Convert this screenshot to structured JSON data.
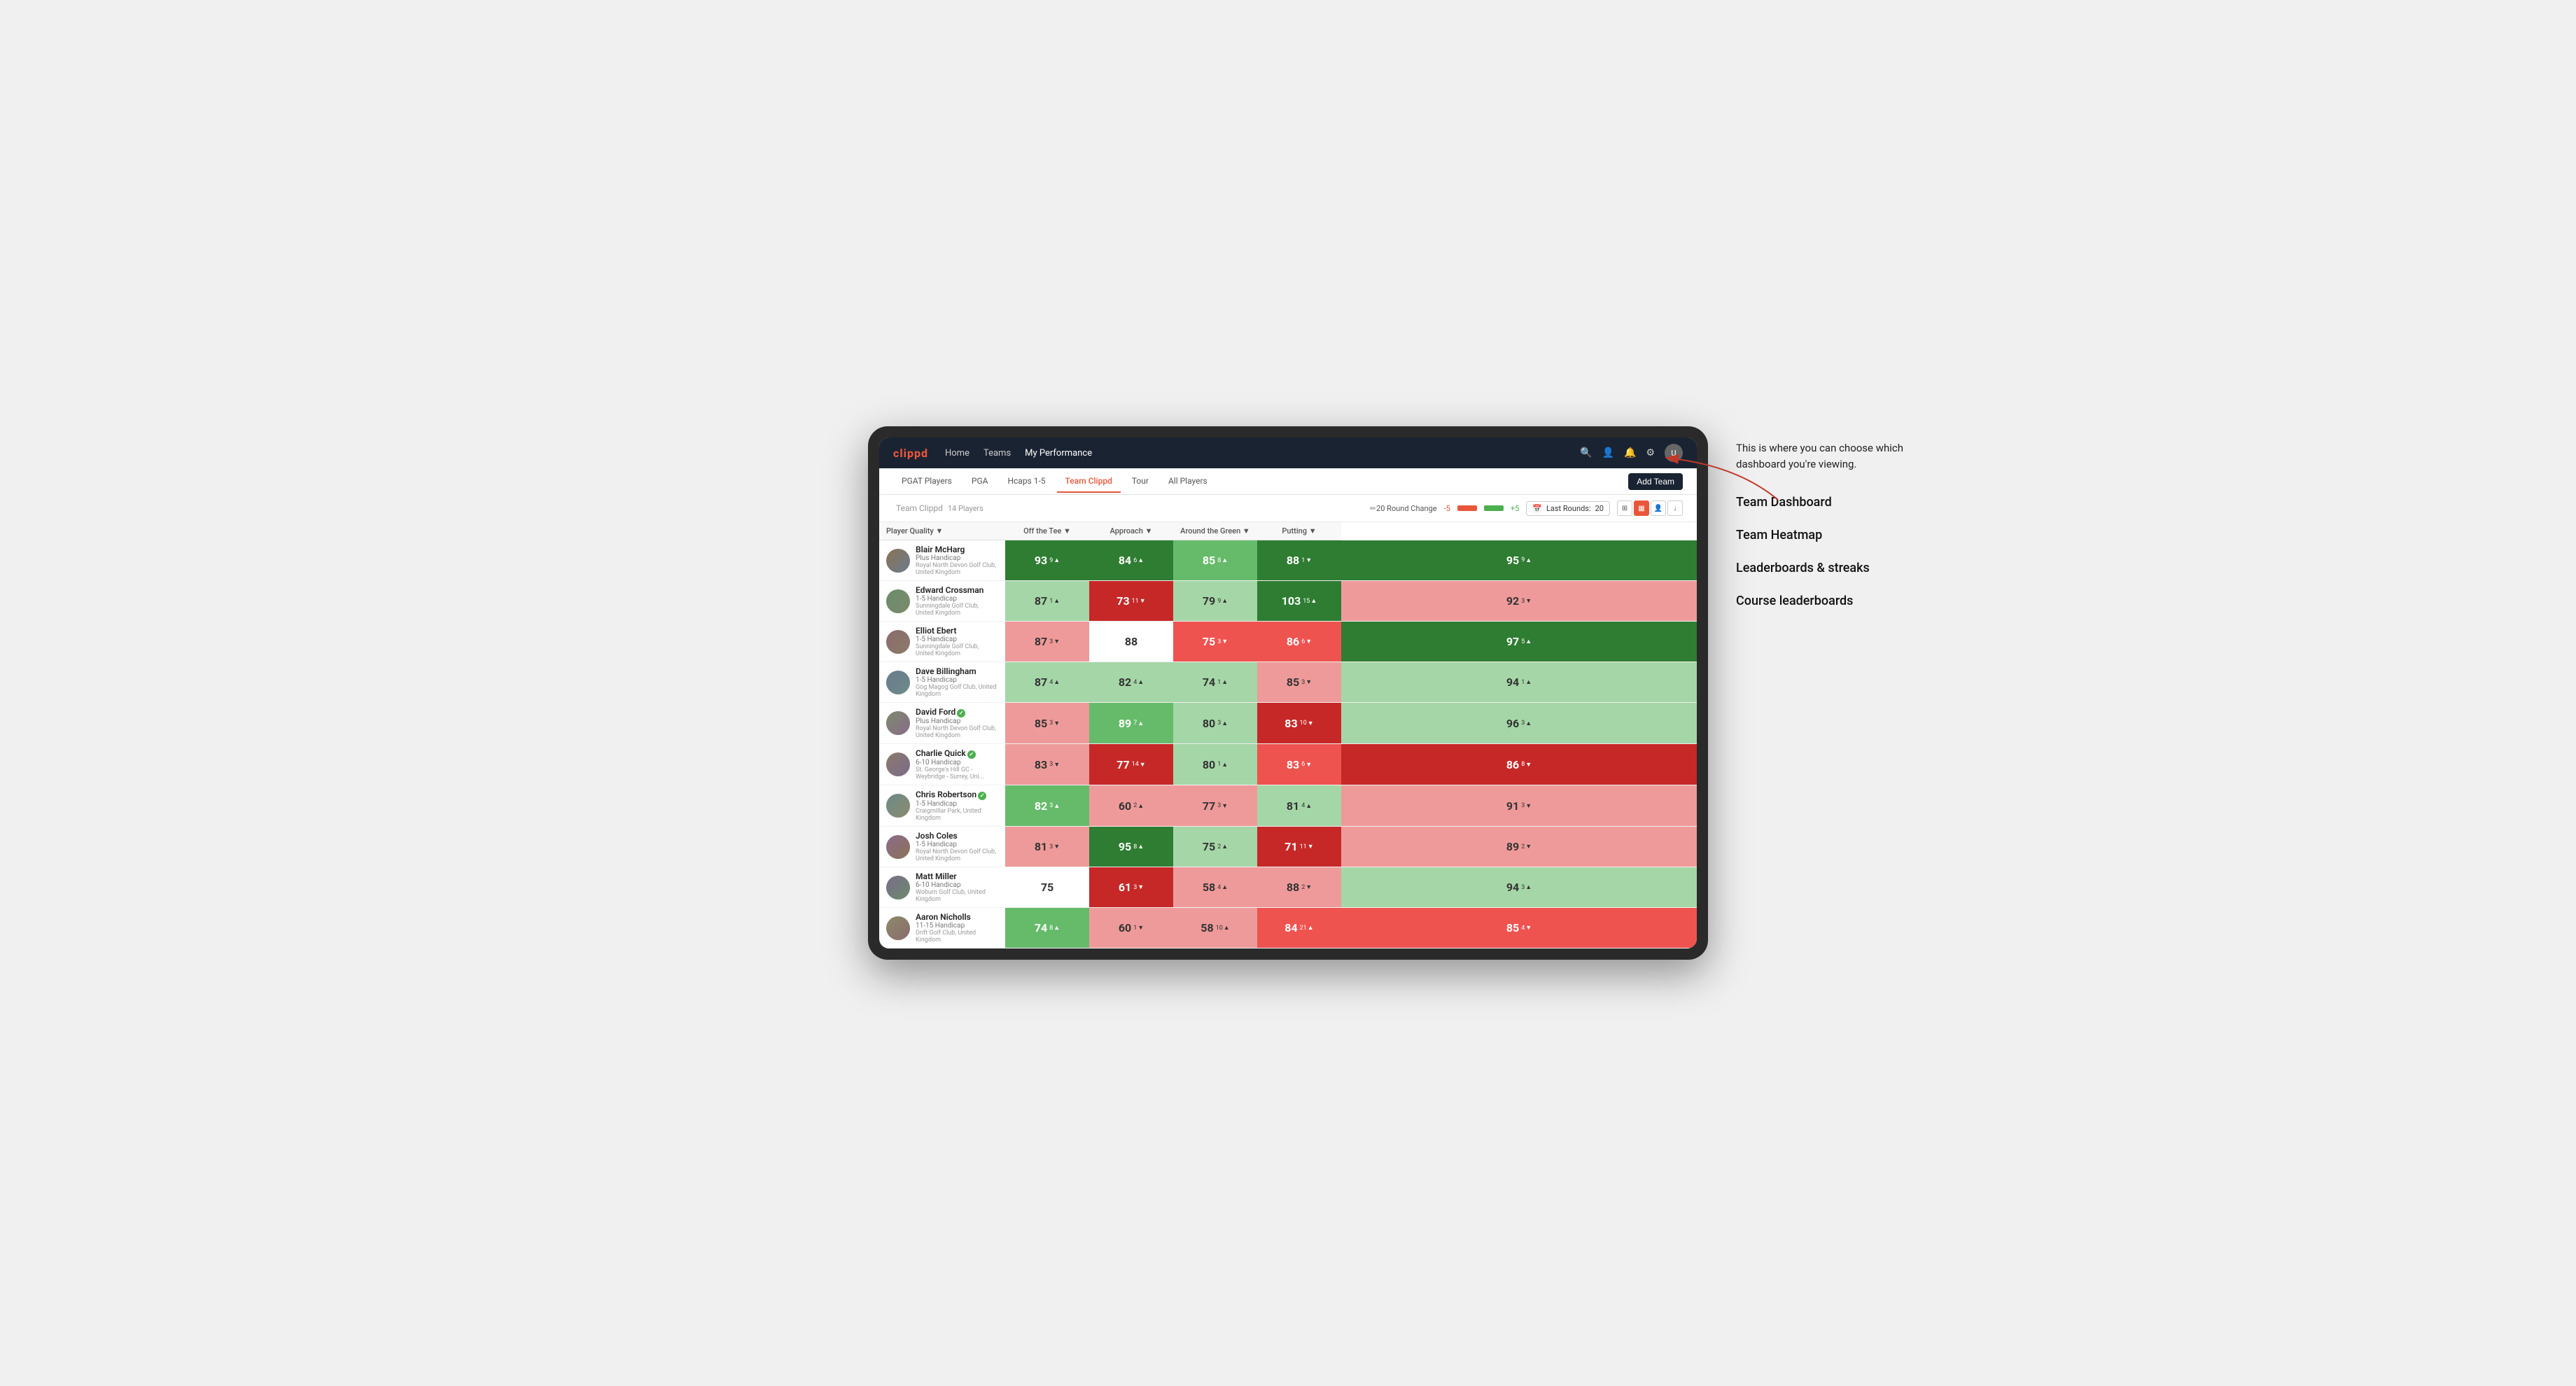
{
  "annotation": {
    "intro": "This is where you can choose which dashboard you're viewing.",
    "items": [
      "Team Dashboard",
      "Team Heatmap",
      "Leaderboards & streaks",
      "Course leaderboards"
    ]
  },
  "nav": {
    "logo": "clippd",
    "items": [
      "Home",
      "Teams",
      "My Performance"
    ],
    "active_item": "My Performance"
  },
  "sub_nav": {
    "tabs": [
      "PGAT Players",
      "PGA",
      "Hcaps 1-5",
      "Team Clippd",
      "Tour",
      "All Players"
    ],
    "active_tab": "Team Clippd",
    "add_team_label": "Add Team"
  },
  "team_header": {
    "team_name": "Team Clippd",
    "player_count": "14 Players",
    "round_change_label": "20 Round Change",
    "round_neg": "-5",
    "round_pos": "+5",
    "last_rounds_label": "Last Rounds:",
    "last_rounds_value": "20"
  },
  "table": {
    "headers": [
      "Player Quality ▼",
      "Off the Tee ▼",
      "Approach ▼",
      "Around the Green ▼",
      "Putting ▼"
    ],
    "players": [
      {
        "name": "Blair McHarg",
        "handicap": "Plus Handicap",
        "club": "Royal North Devon Golf Club, United Kingdom",
        "verified": false,
        "stats": [
          {
            "value": "93",
            "delta": "9",
            "dir": "up",
            "color": "green-dark"
          },
          {
            "value": "84",
            "delta": "6",
            "dir": "up",
            "color": "green-dark"
          },
          {
            "value": "85",
            "delta": "8",
            "dir": "up",
            "color": "green-med"
          },
          {
            "value": "88",
            "delta": "1",
            "dir": "down",
            "color": "green-dark"
          },
          {
            "value": "95",
            "delta": "9",
            "dir": "up",
            "color": "green-dark"
          }
        ]
      },
      {
        "name": "Edward Crossman",
        "handicap": "1-5 Handicap",
        "club": "Sunningdale Golf Club, United Kingdom",
        "verified": false,
        "stats": [
          {
            "value": "87",
            "delta": "1",
            "dir": "up",
            "color": "green-light"
          },
          {
            "value": "73",
            "delta": "11",
            "dir": "down",
            "color": "red-dark"
          },
          {
            "value": "79",
            "delta": "9",
            "dir": "up",
            "color": "green-light"
          },
          {
            "value": "103",
            "delta": "15",
            "dir": "up",
            "color": "green-dark"
          },
          {
            "value": "92",
            "delta": "3",
            "dir": "down",
            "color": "red-light"
          }
        ]
      },
      {
        "name": "Elliot Ebert",
        "handicap": "1-5 Handicap",
        "club": "Sunningdale Golf Club, United Kingdom",
        "verified": false,
        "stats": [
          {
            "value": "87",
            "delta": "3",
            "dir": "down",
            "color": "red-light"
          },
          {
            "value": "88",
            "delta": "",
            "dir": "",
            "color": "white-cell"
          },
          {
            "value": "75",
            "delta": "3",
            "dir": "down",
            "color": "red-med"
          },
          {
            "value": "86",
            "delta": "6",
            "dir": "down",
            "color": "red-med"
          },
          {
            "value": "97",
            "delta": "5",
            "dir": "up",
            "color": "green-dark"
          }
        ]
      },
      {
        "name": "Dave Billingham",
        "handicap": "1-5 Handicap",
        "club": "Gog Magog Golf Club, United Kingdom",
        "verified": false,
        "stats": [
          {
            "value": "87",
            "delta": "4",
            "dir": "up",
            "color": "green-light"
          },
          {
            "value": "82",
            "delta": "4",
            "dir": "up",
            "color": "green-light"
          },
          {
            "value": "74",
            "delta": "1",
            "dir": "up",
            "color": "green-light"
          },
          {
            "value": "85",
            "delta": "3",
            "dir": "down",
            "color": "red-light"
          },
          {
            "value": "94",
            "delta": "1",
            "dir": "up",
            "color": "green-light"
          }
        ]
      },
      {
        "name": "David Ford",
        "handicap": "Plus Handicap",
        "club": "Royal North Devon Golf Club, United Kingdom",
        "verified": true,
        "stats": [
          {
            "value": "85",
            "delta": "3",
            "dir": "down",
            "color": "red-light"
          },
          {
            "value": "89",
            "delta": "7",
            "dir": "up",
            "color": "green-med"
          },
          {
            "value": "80",
            "delta": "3",
            "dir": "up",
            "color": "green-light"
          },
          {
            "value": "83",
            "delta": "10",
            "dir": "down",
            "color": "red-dark"
          },
          {
            "value": "96",
            "delta": "3",
            "dir": "up",
            "color": "green-light"
          }
        ]
      },
      {
        "name": "Charlie Quick",
        "handicap": "6-10 Handicap",
        "club": "St. George's Hill GC - Weybridge - Surrey, Uni...",
        "verified": true,
        "stats": [
          {
            "value": "83",
            "delta": "3",
            "dir": "down",
            "color": "red-light"
          },
          {
            "value": "77",
            "delta": "14",
            "dir": "down",
            "color": "red-dark"
          },
          {
            "value": "80",
            "delta": "1",
            "dir": "up",
            "color": "green-light"
          },
          {
            "value": "83",
            "delta": "6",
            "dir": "down",
            "color": "red-med"
          },
          {
            "value": "86",
            "delta": "8",
            "dir": "down",
            "color": "red-dark"
          }
        ]
      },
      {
        "name": "Chris Robertson",
        "handicap": "1-5 Handicap",
        "club": "Craigmillar Park, United Kingdom",
        "verified": true,
        "stats": [
          {
            "value": "82",
            "delta": "3",
            "dir": "up",
            "color": "green-med"
          },
          {
            "value": "60",
            "delta": "2",
            "dir": "up",
            "color": "red-light"
          },
          {
            "value": "77",
            "delta": "3",
            "dir": "down",
            "color": "red-light"
          },
          {
            "value": "81",
            "delta": "4",
            "dir": "up",
            "color": "green-light"
          },
          {
            "value": "91",
            "delta": "3",
            "dir": "down",
            "color": "red-light"
          }
        ]
      },
      {
        "name": "Josh Coles",
        "handicap": "1-5 Handicap",
        "club": "Royal North Devon Golf Club, United Kingdom",
        "verified": false,
        "stats": [
          {
            "value": "81",
            "delta": "3",
            "dir": "down",
            "color": "red-light"
          },
          {
            "value": "95",
            "delta": "8",
            "dir": "up",
            "color": "green-dark"
          },
          {
            "value": "75",
            "delta": "2",
            "dir": "up",
            "color": "green-light"
          },
          {
            "value": "71",
            "delta": "11",
            "dir": "down",
            "color": "red-dark"
          },
          {
            "value": "89",
            "delta": "2",
            "dir": "down",
            "color": "red-light"
          }
        ]
      },
      {
        "name": "Matt Miller",
        "handicap": "6-10 Handicap",
        "club": "Woburn Golf Club, United Kingdom",
        "verified": false,
        "stats": [
          {
            "value": "75",
            "delta": "",
            "dir": "",
            "color": "white-cell"
          },
          {
            "value": "61",
            "delta": "3",
            "dir": "down",
            "color": "red-dark"
          },
          {
            "value": "58",
            "delta": "4",
            "dir": "up",
            "color": "red-light"
          },
          {
            "value": "88",
            "delta": "2",
            "dir": "down",
            "color": "red-light"
          },
          {
            "value": "94",
            "delta": "3",
            "dir": "up",
            "color": "green-light"
          }
        ]
      },
      {
        "name": "Aaron Nicholls",
        "handicap": "11-15 Handicap",
        "club": "Drift Golf Club, United Kingdom",
        "verified": false,
        "stats": [
          {
            "value": "74",
            "delta": "8",
            "dir": "up",
            "color": "green-med"
          },
          {
            "value": "60",
            "delta": "1",
            "dir": "down",
            "color": "red-light"
          },
          {
            "value": "58",
            "delta": "10",
            "dir": "up",
            "color": "red-light"
          },
          {
            "value": "84",
            "delta": "21",
            "dir": "up",
            "color": "red-med"
          },
          {
            "value": "85",
            "delta": "4",
            "dir": "down",
            "color": "red-med"
          }
        ]
      }
    ]
  }
}
